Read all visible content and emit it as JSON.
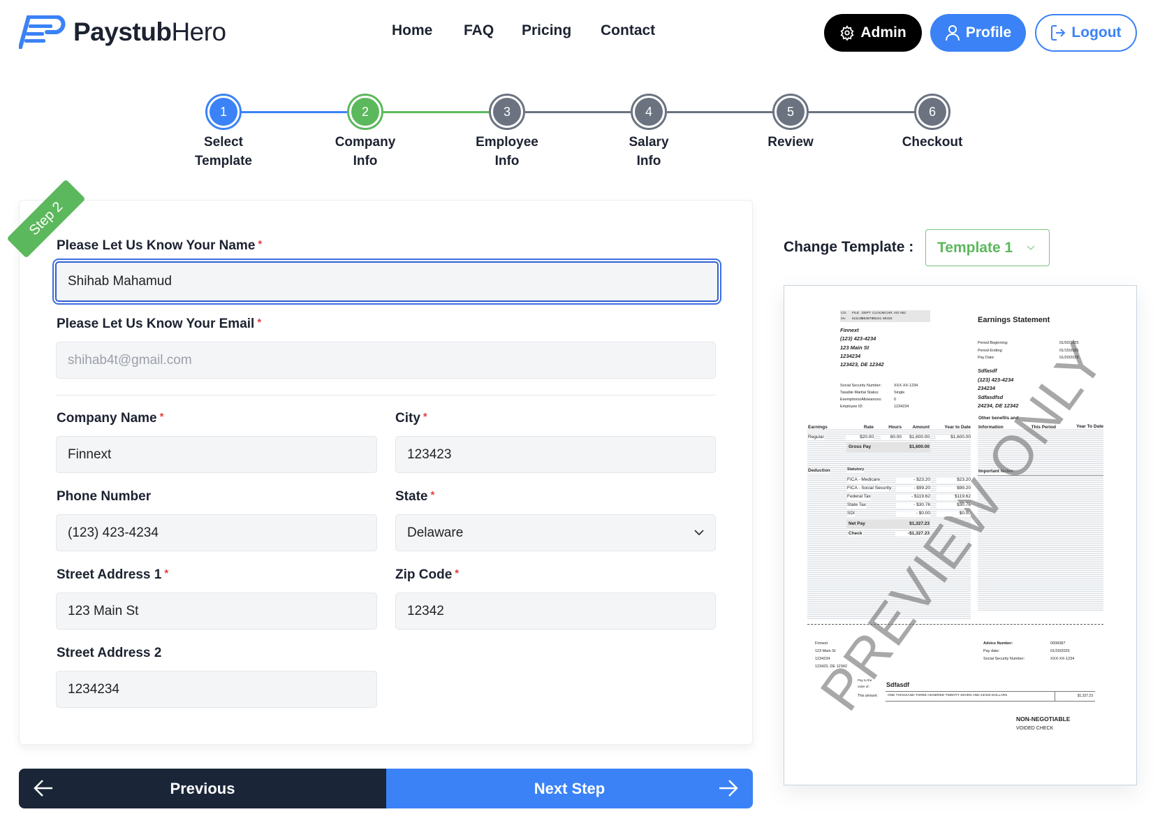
{
  "header": {
    "brand_bold": "Paystub",
    "brand_light": "Hero",
    "nav": [
      "Home",
      "FAQ",
      "Pricing",
      "Contact"
    ],
    "admin_label": "Admin",
    "profile_label": "Profile",
    "logout_label": "Logout"
  },
  "colors": {
    "primary": "#3b82f6",
    "success": "#5cb85c",
    "dark": "#1a2638",
    "inactive": "#6b7280"
  },
  "stepper": {
    "current": 2,
    "steps": [
      {
        "num": "1",
        "line1": "Select",
        "line2": "Template",
        "state": "done"
      },
      {
        "num": "2",
        "line1": "Company",
        "line2": "Info",
        "state": "current"
      },
      {
        "num": "3",
        "line1": "Employee",
        "line2": "Info",
        "state": "pending"
      },
      {
        "num": "4",
        "line1": "Salary",
        "line2": "Info",
        "state": "pending"
      },
      {
        "num": "5",
        "line1": "Review",
        "line2": "",
        "state": "pending"
      },
      {
        "num": "6",
        "line1": "Checkout",
        "line2": "",
        "state": "pending"
      }
    ]
  },
  "form": {
    "ribbon": "Step 2",
    "required_mark": "*",
    "name": {
      "label": "Please Let Us Know Your Name",
      "value": "Shihab Mahamud"
    },
    "email": {
      "label": "Please Let Us Know Your Email",
      "value": "shihab4t@gmail.com"
    },
    "company": {
      "label": "Company Name",
      "value": "Finnext"
    },
    "city": {
      "label": "City",
      "value": "123423"
    },
    "phone": {
      "label": "Phone Number",
      "value": "(123) 423-4234"
    },
    "state": {
      "label": "State",
      "value": "Delaware"
    },
    "street1": {
      "label": "Street Address 1",
      "value": "123 Main St"
    },
    "zip": {
      "label": "Zip Code",
      "value": "12342"
    },
    "street2": {
      "label": "Street Address 2",
      "value": "1234234"
    }
  },
  "footer_buttons": {
    "previous": "Previous",
    "next": "Next Step"
  },
  "template_picker": {
    "label": "Change Template :",
    "selected": "Template 1"
  },
  "paystub": {
    "watermark": "PREVIEW ONLY",
    "codes_header": [
      "CO.",
      "FILE",
      "DEPT",
      "CLOCK",
      "VCHR. NO",
      "062"
    ],
    "codes_values": [
      "2rv",
      "811139",
      "563670",
      "59241",
      "68433",
      ""
    ],
    "company_lines": [
      "Finnext",
      "(123) 423-4234",
      "123 Main St",
      "1234234",
      "123423, DE 12342"
    ],
    "employee_info": [
      {
        "k": "Social Security Number:",
        "v": "XXX-XX-1234"
      },
      {
        "k": "Taxable Marital Status:",
        "v": "Single"
      },
      {
        "k": "Exemptions/Allowances:",
        "v": "0"
      },
      {
        "k": "Employee ID:",
        "v": "1234234"
      }
    ],
    "title": "Earnings Statement",
    "periods": [
      {
        "k": "Period Beginning:",
        "v": "01/02/2025"
      },
      {
        "k": "Period Ending:",
        "v": "01/15/2025"
      },
      {
        "k": "Pay Date:",
        "v": "01/20/2025"
      }
    ],
    "employee_lines": [
      "Sdfasdf",
      "(123) 423-4234",
      "234234",
      "Sdfasdfsd",
      "24234, DE 12342"
    ],
    "earnings_headers": [
      "Earnings",
      "Rate",
      "Hours",
      "Amount",
      "Year to Date"
    ],
    "earnings_rows": [
      {
        "name": "Regular",
        "rate": "$20.00",
        "hours": "80.00",
        "amount": "$1,600.00",
        "ytd": "$1,600.00"
      }
    ],
    "gross_pay": {
      "label": "Gross Pay",
      "value": "$1,600.00"
    },
    "benefits_headers": [
      "Other benefits and",
      "Information",
      "This Period",
      "Year To Date"
    ],
    "deduction_label": "Deduction",
    "statutory_label": "Statutory",
    "deductions": [
      {
        "name": "FICA - Medicare",
        "amount": "- $23.20",
        "ytd": "$23.20"
      },
      {
        "name": "FICA - Social Security",
        "amount": "- $99.20",
        "ytd": "$99.20"
      },
      {
        "name": "Federal Tax",
        "amount": "- $119.62",
        "ytd": "$119.62"
      },
      {
        "name": "State Tax",
        "amount": "- $30.76",
        "ytd": "$30.76"
      },
      {
        "name": "SDI",
        "amount": "- $0.00",
        "ytd": "$0.00"
      }
    ],
    "net_pay": {
      "label": "Net Pay",
      "value": "$1,327.23"
    },
    "check": {
      "label": "Check",
      "value": "-$1,327.23"
    },
    "important_notes": "Important Notes",
    "stub_company": [
      "Finnext",
      "123 Main St",
      "1234234",
      "123423, DE 12342"
    ],
    "advice": [
      {
        "k": "Advice Number:",
        "v": "0006087"
      },
      {
        "k": "Pay date:",
        "v": "01/20/2025"
      },
      {
        "k": "Social Security Number:",
        "v": "XXX-XX-1234"
      }
    ],
    "pay_to_label_1": "Pay to the",
    "pay_to_label_2": "order of:",
    "payee": "Sdfasdf",
    "amount_label": "This amount:",
    "amount_words": "ONE THOUSAND THREE HUNDRED TWENTY SEVEN AND 23/100 DOLLARS",
    "amount_value": "$1,327.23",
    "non_negotiable": "NON-NEGOTIABLE",
    "voided": "VOIDED CHECK"
  }
}
